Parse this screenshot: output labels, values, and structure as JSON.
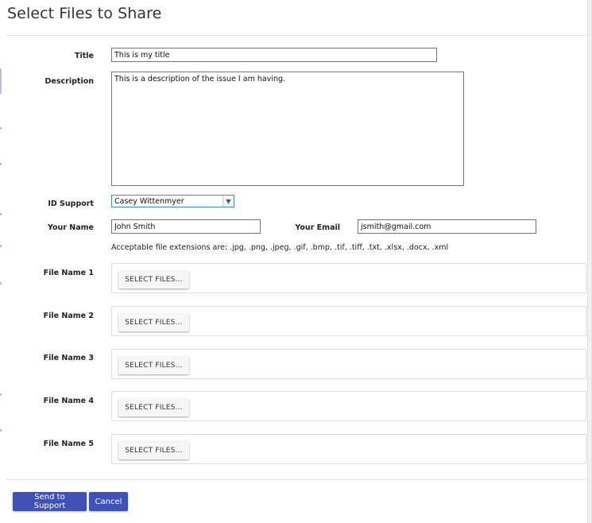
{
  "dialog": {
    "title": "Select Files to Share"
  },
  "form": {
    "title": {
      "label": "Title",
      "value": "This is my title"
    },
    "description": {
      "label": "Description",
      "value": "This is a description of the issue I am having."
    },
    "id_support": {
      "label": "ID Support",
      "selected": "Casey Wittenmyer"
    },
    "your_name": {
      "label": "Your Name",
      "value": "John Smith"
    },
    "your_email": {
      "label": "Your Email",
      "value": "jsmith@gmail.com"
    },
    "extensions_hint": "Acceptable file extensions are: .jpg, .png, .jpeg, .gif, .bmp, .tif, .tiff, .txt, .xlsx, .docx, .xml"
  },
  "files": [
    {
      "label": "File Name 1",
      "button": "SELECT FILES..."
    },
    {
      "label": "File Name 2",
      "button": "SELECT FILES..."
    },
    {
      "label": "File Name 3",
      "button": "SELECT FILES..."
    },
    {
      "label": "File Name 4",
      "button": "SELECT FILES..."
    },
    {
      "label": "File Name 5",
      "button": "SELECT FILES..."
    }
  ],
  "actions": {
    "send_label": "Send to Support",
    "cancel_label": "Cancel"
  },
  "colors": {
    "primary": "#3f51b5",
    "select_border": "#3d8fd1"
  },
  "icons": {
    "dropdown": "chevron-down-icon"
  }
}
